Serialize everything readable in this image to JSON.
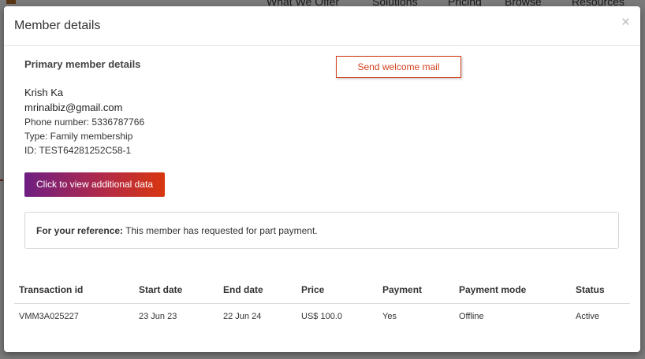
{
  "background": {
    "nav": [
      "What We Offer",
      "Solutions",
      "Pricing",
      "Browse",
      "Resources"
    ]
  },
  "modal": {
    "title": "Member details",
    "close_glyph": "×",
    "section_heading": "Primary member details",
    "welcome_button": "Send welcome mail",
    "member": {
      "name": "Krish Ka",
      "email": "mrinalbiz@gmail.com",
      "phone": "Phone number: 5336787766",
      "type": "Type: Family membership",
      "id": "ID: TEST64281252C58-1"
    },
    "view_data_button": "Click to view additional data",
    "reference": {
      "label": "For your reference:",
      "text": " This member has requested for part payment."
    },
    "transactions": {
      "headers": [
        "Transaction id",
        "Start date",
        "End date",
        "Price",
        "Payment",
        "Payment mode",
        "Status"
      ],
      "rows": [
        [
          "VMM3A025227",
          "23 Jun 23",
          "22 Jun 24",
          "US$ 100.0",
          "Yes",
          "Offline",
          "Active"
        ]
      ]
    }
  },
  "colors": {
    "accent": "#d2401c",
    "gradient_start": "#6e1e82",
    "gradient_end": "#d9360f"
  }
}
